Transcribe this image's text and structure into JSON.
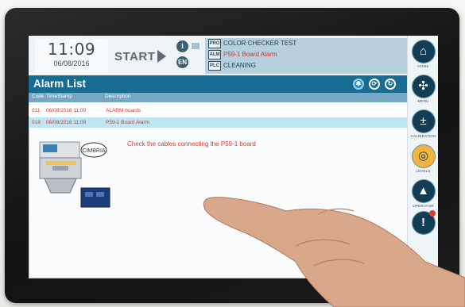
{
  "header": {
    "time": "11:09",
    "date": "06/08/2016",
    "start_label": "START",
    "info_icon": "i",
    "language": "EN",
    "status": [
      {
        "tag": "PRG",
        "value": "COLOR CHECKER TEST",
        "color": "#1c3f55"
      },
      {
        "tag": "ALM",
        "value": "P59-1 Board Alarm",
        "color": "#d2392f"
      },
      {
        "tag": "PLC",
        "value": "CLEANING",
        "color": "#1c3f55"
      }
    ]
  },
  "alarm_list": {
    "title": "Alarm List",
    "columns": {
      "code": "Code",
      "timestamp": "TimeStamp",
      "description": "Description"
    },
    "rows": [
      {
        "code": "011",
        "timestamp": "06/08/2016 11:09",
        "description": "ALARM boards"
      },
      {
        "code": "018",
        "timestamp": "06/08/2016 11:09",
        "description": "P59-1 Board Alarm"
      }
    ],
    "detail_message": "Check the cables connecting the P59-1 board",
    "brand_logo": "CIMBRIA"
  },
  "sidebar": {
    "items": [
      {
        "label": "HOME",
        "icon": "home-icon"
      },
      {
        "label": "MENU",
        "icon": "menu-icon"
      },
      {
        "label": "CALIBRATION",
        "icon": "calibration-icon"
      },
      {
        "label": "LEVELS",
        "icon": "levels-icon"
      },
      {
        "label": "OPERATOR",
        "icon": "operator-icon"
      },
      {
        "label": "",
        "icon": "alarm-icon"
      }
    ]
  },
  "colors": {
    "titlebar": "#176d91",
    "alarm_text": "#d2392f",
    "selected_row": "#bfe4f2",
    "status_panel": "#b6d0de",
    "sidebar_icon": "#113e54"
  }
}
